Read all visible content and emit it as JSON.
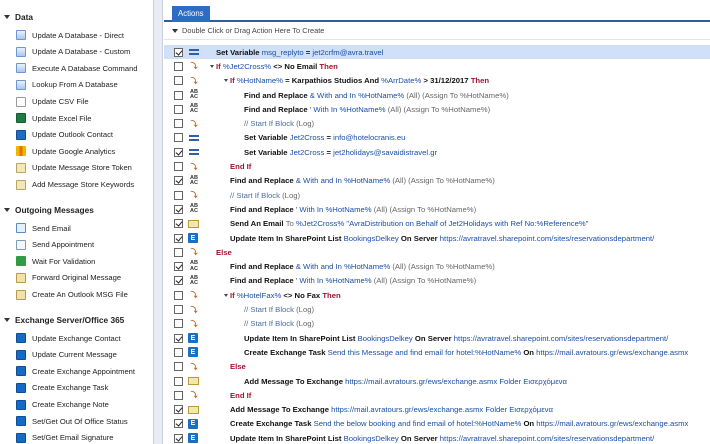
{
  "left_panel": {
    "sections": [
      {
        "title": "Data",
        "items": [
          {
            "label": "Update A Database - Direct",
            "icon": "database-icon"
          },
          {
            "label": "Update A Database - Custom",
            "icon": "database-icon"
          },
          {
            "label": "Execute A Database Command",
            "icon": "database-icon"
          },
          {
            "label": "Lookup From A Database",
            "icon": "database-icon"
          },
          {
            "label": "Update CSV File",
            "icon": "csv-file-icon"
          },
          {
            "label": "Update Excel File",
            "icon": "excel-icon"
          },
          {
            "label": "Update Outlook Contact",
            "icon": "outlook-icon"
          },
          {
            "label": "Update Google Analytics",
            "icon": "google-analytics-icon"
          },
          {
            "label": "Update Message Store Token",
            "icon": "token-icon"
          },
          {
            "label": "Add Message Store Keywords",
            "icon": "keywords-icon"
          }
        ]
      },
      {
        "title": "Outgoing Messages",
        "items": [
          {
            "label": "Send Email",
            "icon": "email-icon"
          },
          {
            "label": "Send Appointment",
            "icon": "appointment-icon"
          },
          {
            "label": "Wait For Validation",
            "icon": "validation-icon"
          },
          {
            "label": "Forward Original Message",
            "icon": "forward-icon"
          },
          {
            "label": "Create An Outlook MSG File",
            "icon": "msg-file-icon"
          }
        ]
      },
      {
        "title": "Exchange Server/Office 365",
        "items": [
          {
            "label": "Update Exchange Contact",
            "icon": "exchange-icon"
          },
          {
            "label": "Update Current Message",
            "icon": "exchange-icon"
          },
          {
            "label": "Create Exchange Appointment",
            "icon": "exchange-icon"
          },
          {
            "label": "Create Exchange Task",
            "icon": "exchange-icon"
          },
          {
            "label": "Create Exchange Note",
            "icon": "exchange-icon"
          },
          {
            "label": "Set/Get Out Of Office Status",
            "icon": "exchange-icon"
          },
          {
            "label": "Set/Get Email Signature",
            "icon": "exchange-icon"
          }
        ]
      }
    ]
  },
  "right_panel": {
    "tab_label": "Actions",
    "hint": "Double Click or Drag Action Here To Create",
    "rows": [
      {
        "parts": [
          [
            "kw",
            "Set Variable "
          ],
          [
            "var",
            "msg_replyto"
          ],
          [
            "op",
            " = "
          ],
          [
            "val",
            "jet2crfm@avra.travel"
          ]
        ]
      },
      {
        "parts": [
          [
            "red",
            "If "
          ],
          [
            "var",
            "%Jet2Cross%"
          ],
          [
            "op",
            " <> "
          ],
          [
            "kw",
            "No Email"
          ],
          [
            "red",
            "  Then"
          ]
        ]
      },
      {
        "parts": [
          [
            "red",
            "If "
          ],
          [
            "var",
            "%HotName%"
          ],
          [
            "op",
            " = "
          ],
          [
            "kw",
            "Karpathios Studios"
          ],
          [
            "op",
            "  And  "
          ],
          [
            "var",
            "%ArrDate%"
          ],
          [
            "op",
            " > "
          ],
          [
            "kw",
            "31/12/2017"
          ],
          [
            "red",
            "  Then"
          ]
        ]
      },
      {
        "parts": [
          [
            "kw",
            "Find and Replace "
          ],
          [
            "var",
            "& With and In %HotName%"
          ],
          [
            "dim",
            " (All)  (Assign To %HotName%)"
          ]
        ]
      },
      {
        "parts": [
          [
            "kw",
            "Find and Replace "
          ],
          [
            "var",
            "' With  In %HotName%"
          ],
          [
            "dim",
            " (All)  (Assign To %HotName%)"
          ]
        ]
      },
      {
        "parts": [
          [
            "cmt",
            "// Start If Block "
          ],
          [
            "dim",
            "(Log)"
          ]
        ]
      },
      {
        "parts": [
          [
            "kw",
            "Set Variable "
          ],
          [
            "var",
            "Jet2Cross"
          ],
          [
            "op",
            " = "
          ],
          [
            "val",
            "info@hotelocranis.eu"
          ]
        ]
      },
      {
        "parts": [
          [
            "kw",
            "Set Variable "
          ],
          [
            "var",
            "Jet2Cross"
          ],
          [
            "op",
            " = "
          ],
          [
            "val",
            "jet2holidays@savaidistravel.gr"
          ]
        ]
      },
      {
        "parts": [
          [
            "red",
            "End If"
          ]
        ]
      },
      {
        "parts": [
          [
            "kw",
            "Find and Replace "
          ],
          [
            "var",
            "& With and In %HotName%"
          ],
          [
            "dim",
            " (All)  (Assign To %HotName%)"
          ]
        ]
      },
      {
        "parts": [
          [
            "cmt",
            "// Start If Block "
          ],
          [
            "dim",
            "(Log)"
          ]
        ]
      },
      {
        "parts": [
          [
            "kw",
            "Find and Replace "
          ],
          [
            "var",
            "' With  In %HotName%"
          ],
          [
            "dim",
            " (All)  (Assign To %HotName%)"
          ]
        ]
      },
      {
        "parts": [
          [
            "kw",
            "Send An Email "
          ],
          [
            "dim",
            "To "
          ],
          [
            "var",
            "%Jet2Cross%"
          ],
          [
            "val",
            " \"AvraDistribution on Behalf of Jet2Holidays with Ref No:%Reference%\""
          ]
        ]
      },
      {
        "parts": [
          [
            "kw",
            "Update Item In SharePoint List "
          ],
          [
            "var",
            "BookingsDelkey"
          ],
          [
            "kw",
            " On Server "
          ],
          [
            "val",
            "https://avratravel.sharepoint.com/sites/reservationsdepartment/"
          ]
        ]
      },
      {
        "parts": [
          [
            "red",
            "Else"
          ]
        ]
      },
      {
        "parts": [
          [
            "kw",
            "Find and Replace "
          ],
          [
            "var",
            "& With and In %HotName%"
          ],
          [
            "dim",
            " (All)  (Assign To %HotName%)"
          ]
        ]
      },
      {
        "parts": [
          [
            "kw",
            "Find and Replace "
          ],
          [
            "var",
            "' With  In %HotName%"
          ],
          [
            "dim",
            " (All)  (Assign To %HotName%)"
          ]
        ]
      },
      {
        "parts": [
          [
            "red",
            "If "
          ],
          [
            "var",
            "%HotelFax%"
          ],
          [
            "op",
            " <> "
          ],
          [
            "kw",
            "No Fax"
          ],
          [
            "red",
            "  Then"
          ]
        ]
      },
      {
        "parts": [
          [
            "cmt",
            "// Start If Block "
          ],
          [
            "dim",
            "(Log)"
          ]
        ]
      },
      {
        "parts": [
          [
            "cmt",
            "// Start If Block "
          ],
          [
            "dim",
            "(Log)"
          ]
        ]
      },
      {
        "parts": [
          [
            "kw",
            "Update Item In SharePoint List "
          ],
          [
            "var",
            "BookingsDelkey"
          ],
          [
            "kw",
            " On Server "
          ],
          [
            "val",
            "https://avratravel.sharepoint.com/sites/reservationsdepartment/"
          ]
        ]
      },
      {
        "parts": [
          [
            "kw",
            "Create Exchange Task "
          ],
          [
            "var",
            "Send this Message and find email for hotel:%HotName%"
          ],
          [
            "kw",
            " On "
          ],
          [
            "val",
            "https://mail.avratours.gr/ews/exchange.asmx"
          ]
        ]
      },
      {
        "parts": [
          [
            "red",
            "Else"
          ]
        ]
      },
      {
        "parts": [
          [
            "kw",
            "Add Message To Exchange "
          ],
          [
            "val",
            "https://mail.avratours.gr/ews/exchange.asmx"
          ],
          [
            "var",
            " Folder Εισερχόμενα"
          ]
        ]
      },
      {
        "parts": [
          [
            "red",
            "End If"
          ]
        ]
      },
      {
        "parts": [
          [
            "kw",
            "Add Message To Exchange "
          ],
          [
            "val",
            "https://mail.avratours.gr/ews/exchange.asmx"
          ],
          [
            "var",
            " Folder Εισερχόμενα"
          ]
        ]
      },
      {
        "parts": [
          [
            "kw",
            "Create Exchange Task "
          ],
          [
            "var",
            "Send the below booking and find email of hotel:%HotName%"
          ],
          [
            "kw",
            " On "
          ],
          [
            "val",
            "https://mail.avratours.gr/ews/exchange.asmx"
          ]
        ]
      },
      {
        "parts": [
          [
            "kw",
            "Update Item In SharePoint List "
          ],
          [
            "var",
            "BookingsDelkey"
          ],
          [
            "kw",
            " On Server "
          ],
          [
            "val",
            "https://avratravel.sharepoint.com/sites/reservationsdepartment/"
          ]
        ]
      }
    ]
  }
}
